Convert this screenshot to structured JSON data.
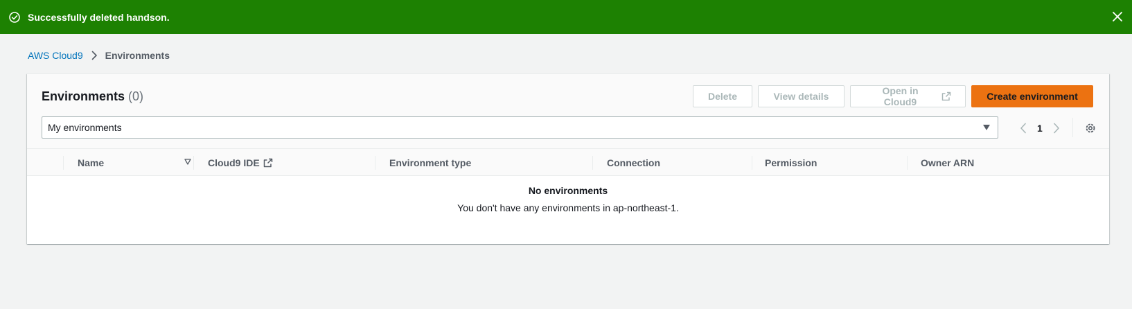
{
  "flash": {
    "message": "Successfully deleted handson.",
    "status_icon": "check-circle-icon",
    "close_icon": "close-icon",
    "color": "#1d8102"
  },
  "breadcrumb": {
    "parent": "AWS Cloud9",
    "current": "Environments"
  },
  "panel": {
    "title": "Environments",
    "count": "(0)"
  },
  "actions": {
    "delete": "Delete",
    "view_details": "View details",
    "open_in_cloud9": "Open in Cloud9",
    "create": "Create environment",
    "create_color": "#ec7211"
  },
  "filter": {
    "selected": "My environments"
  },
  "pagination": {
    "current_page": "1"
  },
  "table": {
    "columns": [
      "Name",
      "Cloud9 IDE",
      "Environment type",
      "Connection",
      "Permission",
      "Owner ARN"
    ],
    "empty_title": "No environments",
    "empty_message": "You don't have any environments in ap-northeast-1."
  }
}
